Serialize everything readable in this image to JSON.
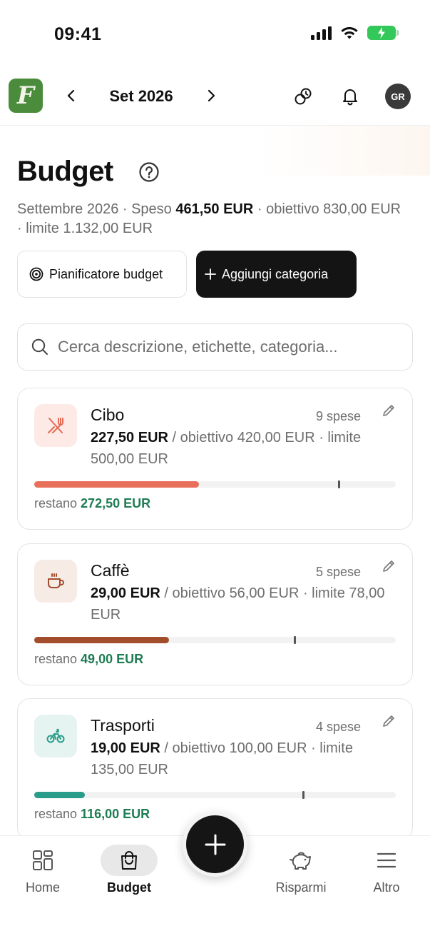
{
  "status_bar": {
    "time": "09:41"
  },
  "header": {
    "month": "Set 2026",
    "avatar_initials": "GR",
    "logo_letter": "F"
  },
  "page": {
    "title": "Budget",
    "summary_period": "Settembre 2026 · Speso ",
    "summary_spent": "461,50 EUR",
    "summary_rest": " · obiettivo 830,00 EUR · limite 1.132,00 EUR"
  },
  "actions": {
    "planner_label": "Pianificatore budget",
    "add_category_label": "Aggiungi categoria"
  },
  "search": {
    "placeholder": "Cerca descrizione, etichette, categoria..."
  },
  "categories": [
    {
      "name": "Cibo",
      "count": "9 spese",
      "spent": "227,50 EUR",
      "detail": " / obiettivo 420,00 EUR · limite 500,00 EUR",
      "remaining_label": "restano ",
      "remaining": "272,50 EUR",
      "progress": 0.455,
      "target_mark": 0.84,
      "color": "#e8705a",
      "icon_bg": "#fdeae6",
      "icon": "fork-knife-icon"
    },
    {
      "name": "Caffè",
      "count": "5 spese",
      "spent": "29,00 EUR",
      "detail": " / obiettivo 56,00 EUR · limite 78,00 EUR",
      "remaining_label": "restano ",
      "remaining": "49,00 EUR",
      "progress": 0.372,
      "target_mark": 0.718,
      "color": "#a24e2c",
      "icon_bg": "#f7ebe6",
      "icon": "coffee-cup-icon"
    },
    {
      "name": "Trasporti",
      "count": "4 spese",
      "spent": "19,00 EUR",
      "detail": " / obiettivo 100,00 EUR · limite 135,00 EUR",
      "remaining_label": "restano ",
      "remaining": "116,00 EUR",
      "progress": 0.141,
      "target_mark": 0.741,
      "color": "#2a9d8a",
      "icon_bg": "#e6f4f1",
      "icon": "bicycle-icon"
    }
  ],
  "tabs": [
    {
      "label": "Home",
      "icon": "grid-icon",
      "active": false
    },
    {
      "label": "Budget",
      "icon": "shopping-bag-icon",
      "active": true
    },
    {
      "label": "Risparmi",
      "icon": "piggy-bank-icon",
      "active": false
    },
    {
      "label": "Altro",
      "icon": "menu-icon",
      "active": false
    }
  ],
  "colors": {
    "accent_green": "#4a8c3b",
    "remaining_green": "#1e7c52",
    "dark_button": "#141414"
  }
}
